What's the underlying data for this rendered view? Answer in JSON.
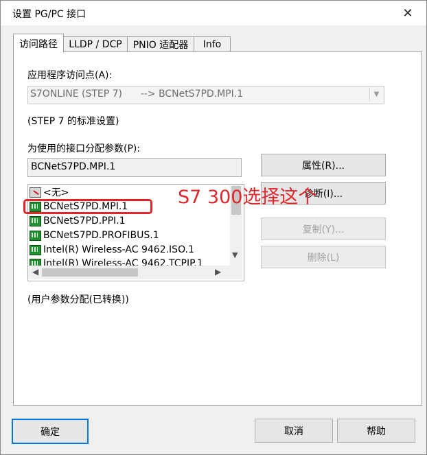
{
  "window": {
    "title": "设置 PG/PC 接口",
    "close_glyph": "✕"
  },
  "tabs": [
    {
      "label": "访问路径",
      "active": true
    },
    {
      "label": "LLDP / DCP",
      "active": false
    },
    {
      "label": "PNIO 适配器",
      "active": false
    },
    {
      "label": "Info",
      "active": false
    }
  ],
  "access_point": {
    "label": "应用程序访问点(A):",
    "value": "S7ONLINE (STEP 7)      --> BCNetS7PD.MPI.1",
    "note": "(STEP 7 的标准设置)"
  },
  "interface": {
    "label": "为使用的接口分配参数(P):",
    "value": "BCNetS7PD.MPI.1",
    "items": [
      {
        "label": "<无>",
        "icon": "no-interface-icon"
      },
      {
        "label": "BCNetS7PD.MPI.1",
        "icon": "network-card-icon"
      },
      {
        "label": "BCNetS7PD.PPI.1",
        "icon": "network-card-icon"
      },
      {
        "label": "BCNetS7PD.PROFIBUS.1",
        "icon": "network-card-icon"
      },
      {
        "label": "Intel(R) Wireless-AC 9462.ISO.1",
        "icon": "network-card-icon"
      },
      {
        "label": "Intel(R) Wireless-AC 9462.TCPIP.1",
        "icon": "network-card-icon"
      }
    ],
    "status": "(用户参数分配(已转换))"
  },
  "side_buttons": {
    "properties": "属性(R)...",
    "diagnostics": "诊断(I)...",
    "copy": "复制(Y)...",
    "delete": "删除(L)"
  },
  "annotation": "S7 300选择这个",
  "bottom_buttons": {
    "ok": "确定",
    "cancel": "取消",
    "help": "帮助"
  },
  "colors": {
    "annotation_red": "#e0262a",
    "focus_blue": "#0078d7"
  }
}
